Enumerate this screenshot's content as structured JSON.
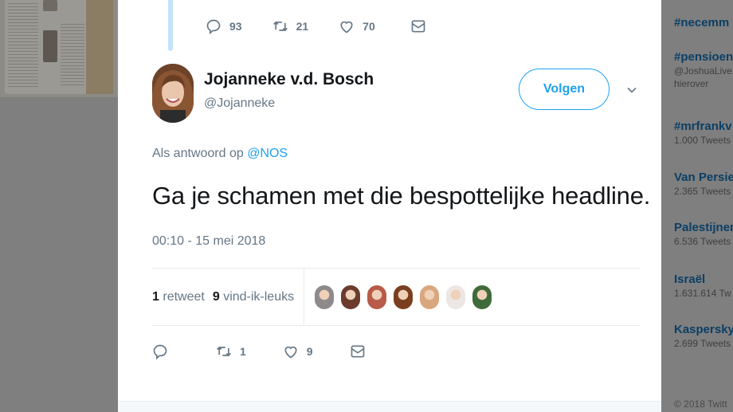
{
  "top_tweet_actions": {
    "reply_count": "93",
    "retweet_count": "21",
    "like_count": "70"
  },
  "tweet": {
    "author_name": "Jojanneke v.d. Bosch",
    "author_handle": "@Jojanneke",
    "follow_label": "Volgen",
    "reply_prefix": "Als antwoord op",
    "reply_mention": "@NOS",
    "text": "Ga je schamen met die bespottelijke headline.",
    "timestamp": "00:10 - 15 mei 2018",
    "retweets_count": "1",
    "retweets_label": "retweet",
    "likes_count": "9",
    "likes_label": "vind-ik-leuks",
    "actions": {
      "reply_count": "",
      "retweet_count": "1",
      "like_count": "9"
    }
  },
  "likers": [
    {
      "color": "#8e8a8c"
    },
    {
      "color": "#6b3b2e"
    },
    {
      "color": "#b85b4a"
    },
    {
      "color": "#7a3f1e"
    },
    {
      "color": "#d9a77e"
    },
    {
      "color": "#ece7e4"
    },
    {
      "color": "#3f6b3a"
    }
  ],
  "trends": [
    {
      "name": "#necemm",
      "sub": ""
    },
    {
      "name": "#pensioen",
      "sub": "@JoshuaLive"
    },
    {
      "name": "",
      "sub": "hierover"
    },
    {
      "name": "#mrfrankv",
      "sub": "1.000 Tweets"
    },
    {
      "name": "Van Persie",
      "sub": "2.365 Tweets"
    },
    {
      "name": "Palestijnen",
      "sub": "6.536 Tweets"
    },
    {
      "name": "Israël",
      "sub": "1.631.614 Tw"
    },
    {
      "name": "Kaspersky",
      "sub": "2.699 Tweets"
    }
  ],
  "footer": {
    "copyright": "© 2018 Twitt"
  },
  "colors": {
    "accent": "#1da1f2",
    "muted": "#657786",
    "text": "#14171a"
  }
}
